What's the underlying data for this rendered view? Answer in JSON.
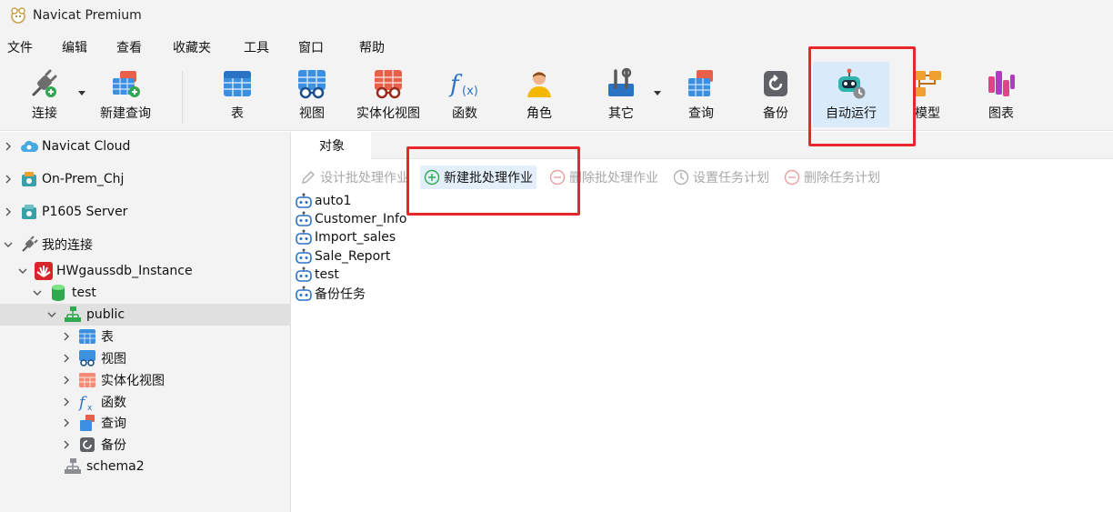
{
  "window": {
    "title": "Navicat Premium",
    "logo_icon": "navicat-logo-icon"
  },
  "menu": [
    "文件",
    "编辑",
    "查看",
    "收藏夹",
    "工具",
    "窗口",
    "帮助"
  ],
  "toolbar": {
    "connect": "连接",
    "new_query": "新建查询",
    "table": "表",
    "view": "视图",
    "materialized_view": "实体化视图",
    "function": "函数",
    "role": "角色",
    "other": "其它",
    "query": "查询",
    "backup": "备份",
    "automation": "自动运行",
    "model": "模型",
    "chart": "图表"
  },
  "tree": {
    "navicat_cloud": "Navicat Cloud",
    "on_prem": "On-Prem_Chj",
    "p1605": "P1605 Server",
    "my_connections": "我的连接",
    "instance": "HWgaussdb_Instance",
    "database": "test",
    "schema_public": "public",
    "table": "表",
    "view": "视图",
    "materialized_view": "实体化视图",
    "function": "函数",
    "query": "查询",
    "backup": "备份",
    "schema2": "schema2"
  },
  "tabs": {
    "objects": "对象"
  },
  "actions": {
    "design": "设计批处理作业",
    "new": "新建批处理作业",
    "delete": "删除批处理作业",
    "schedule": "设置任务计划",
    "delete_schedule": "删除任务计划"
  },
  "jobs": [
    "auto1",
    "Customer_Info",
    "Import_sales",
    "Sale_Report",
    "test",
    "备份任务"
  ],
  "colors": {
    "accent": "#d9ebfa",
    "annotation": "#e8262b",
    "selection": "#e0e0e0"
  }
}
